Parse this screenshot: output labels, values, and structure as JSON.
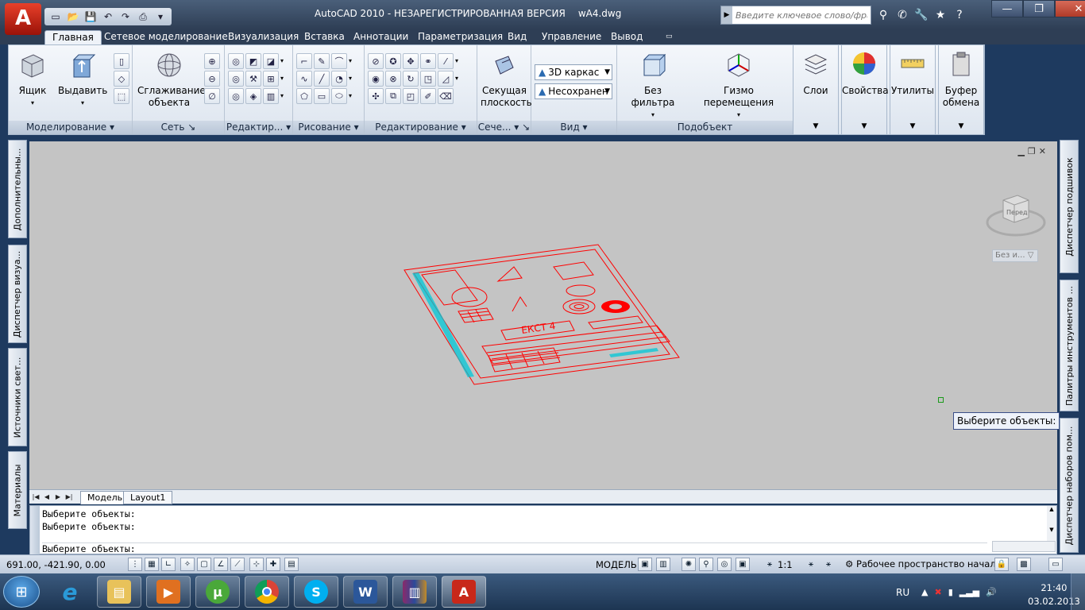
{
  "app": {
    "logo_letter": "A",
    "title": "AutoCAD 2010 - НЕЗАРЕГИСТРИРОВАННАЯ ВЕРСИЯ",
    "filename": "wA4.dwg",
    "search_placeholder": "Введите ключевое слово/фразу"
  },
  "ribbon_tabs": [
    {
      "label": "Главная",
      "active": true
    },
    {
      "label": "Сетевое моделирование"
    },
    {
      "label": "Визуализация"
    },
    {
      "label": "Вставка"
    },
    {
      "label": "Аннотации"
    },
    {
      "label": "Параметризация"
    },
    {
      "label": "Вид"
    },
    {
      "label": "Управление"
    },
    {
      "label": "Вывод"
    }
  ],
  "panels": {
    "modeling": {
      "title": "Моделирование",
      "box": "Ящик",
      "extrude": "Выдавить"
    },
    "mesh": {
      "title": "Сеть",
      "smooth_line1": "Сглаживание",
      "smooth_line2": "объекта"
    },
    "solid_edit": {
      "title": "Редактир..."
    },
    "draw": {
      "title": "Рисование"
    },
    "modify": {
      "title": "Редактирование"
    },
    "section": {
      "title": "Сече...",
      "plane_line1": "Секущая",
      "plane_line2": "плоскость"
    },
    "view": {
      "title": "Вид",
      "visual_style": "3D каркас",
      "named_view": "Несохранен"
    },
    "subobject": {
      "title": "Подобъект",
      "filter": "Без фильтра",
      "gizmo": "Гизмо перемещения"
    },
    "layers": "Слои",
    "properties": "Свойства",
    "utilities": "Утилиты",
    "clipboard_line1": "Буфер",
    "clipboard_line2": "обмена"
  },
  "left_palettes": [
    "Дополнительны...",
    "Диспетчер визуа...",
    "Источники свет...",
    "Материалы"
  ],
  "right_palettes": [
    "Диспетчер подшивок",
    "Палитры инструментов ...",
    "Диспетчер наборов пом..."
  ],
  "viewport": {
    "viewcube_face": "Перед",
    "ucs_label": "Без и...",
    "tooltip": "Выберите объекты:",
    "drawing_text": "ЕКСТ 4"
  },
  "layout_tabs": [
    {
      "label": "Модель",
      "active": true
    },
    {
      "label": "Layout1"
    }
  ],
  "command_lines": [
    "Выберите объекты:",
    "Выберите объекты:",
    "Выберите объекты:"
  ],
  "statusbar": {
    "coords": "691.00, -421.90, 0.00",
    "model": "МОДЕЛЬ",
    "scale": "1:1",
    "workspace": "Рабочее пространство началь"
  },
  "taskbar": {
    "lang": "RU",
    "time": "21:40",
    "date": "03.02.2013"
  },
  "colors": {
    "drawing_red": "#ff0000",
    "drawing_cyan": "#00c8d8",
    "viewport_bg": "#c4c4c4"
  }
}
